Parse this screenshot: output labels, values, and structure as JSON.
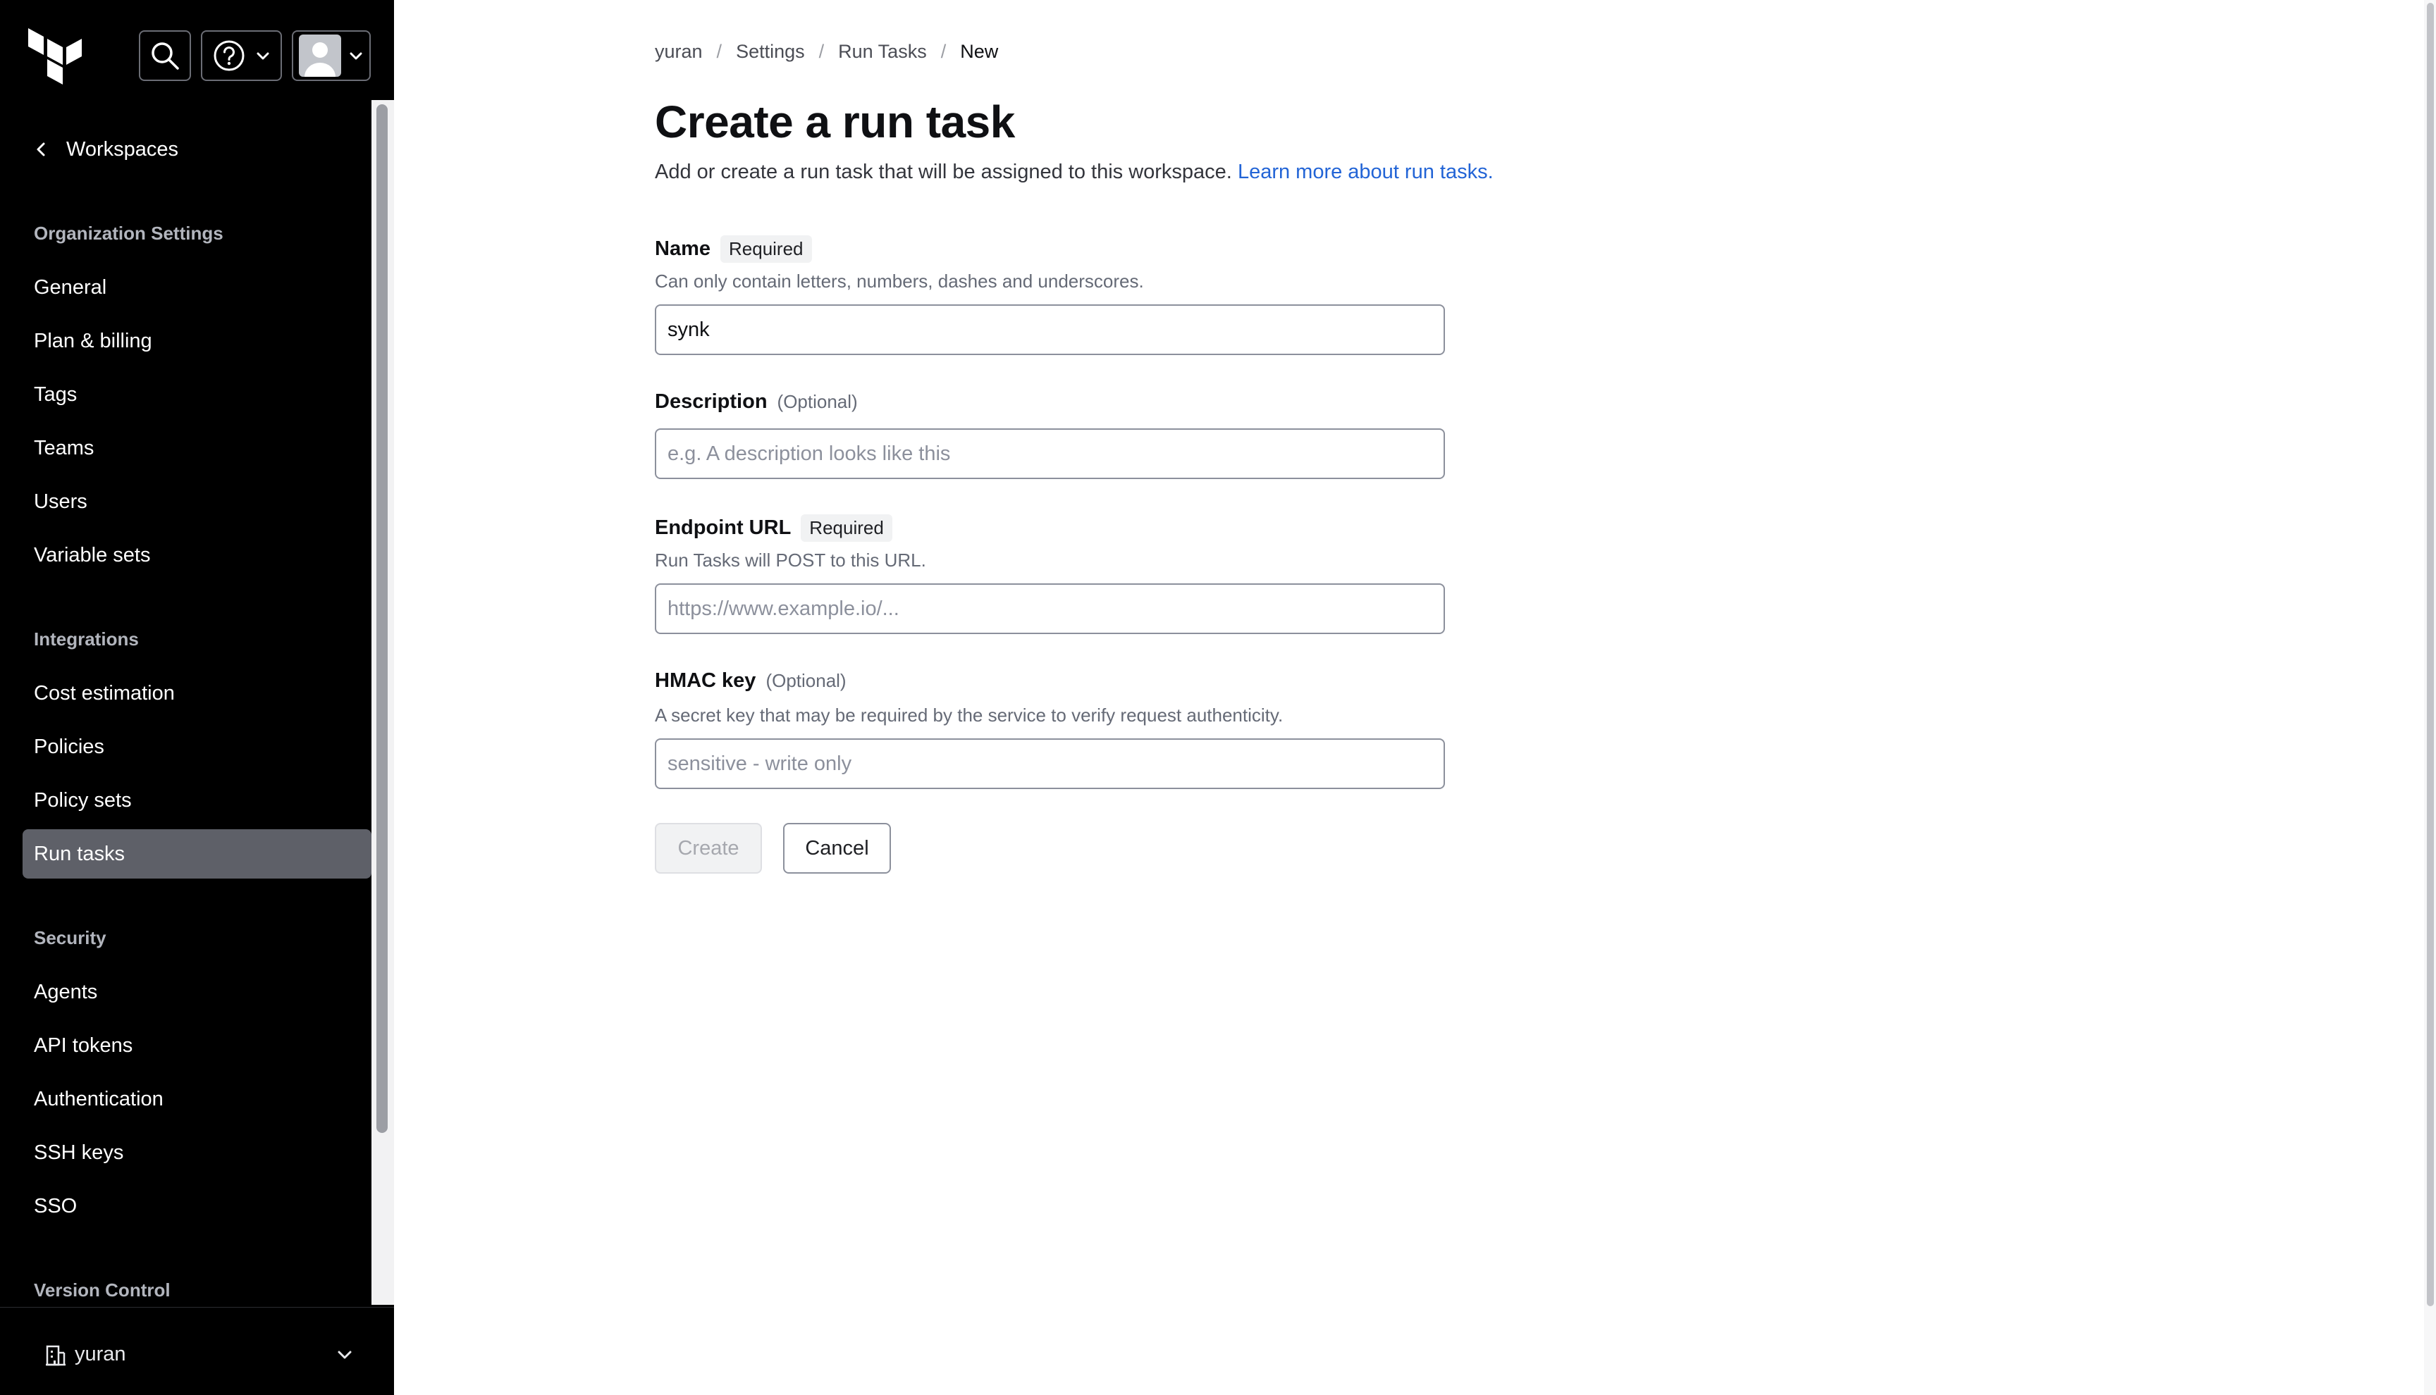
{
  "sidebar": {
    "back_label": "Workspaces",
    "sections": [
      {
        "heading": "Organization Settings",
        "items": [
          "General",
          "Plan & billing",
          "Tags",
          "Teams",
          "Users",
          "Variable sets"
        ]
      },
      {
        "heading": "Integrations",
        "items": [
          "Cost estimation",
          "Policies",
          "Policy sets",
          "Run tasks"
        ]
      },
      {
        "heading": "Security",
        "items": [
          "Agents",
          "API tokens",
          "Authentication",
          "SSH keys",
          "SSO"
        ]
      },
      {
        "heading": "Version Control",
        "items": []
      }
    ],
    "active_item": "Run tasks",
    "org_name": "yuran"
  },
  "breadcrumb": [
    "yuran",
    "Settings",
    "Run Tasks",
    "New"
  ],
  "page": {
    "title": "Create a run task",
    "description": "Add or create a run task that will be assigned to this workspace.",
    "learn_more": "Learn more about run tasks."
  },
  "form": {
    "name": {
      "label": "Name",
      "badge": "Required",
      "help": "Can only contain letters, numbers, dashes and underscores.",
      "value": "synk",
      "placeholder": ""
    },
    "description": {
      "label": "Description",
      "optional": "(Optional)",
      "value": "",
      "placeholder": "e.g. A description looks like this"
    },
    "endpoint": {
      "label": "Endpoint URL",
      "badge": "Required",
      "help": "Run Tasks will POST to this URL.",
      "value": "",
      "placeholder": "https://www.example.io/..."
    },
    "hmac": {
      "label": "HMAC key",
      "optional": "(Optional)",
      "help": "A secret key that may be required by the service to verify request authenticity.",
      "value": "",
      "placeholder": "sensitive - write only"
    },
    "create_label": "Create",
    "cancel_label": "Cancel"
  },
  "icons": {
    "logo": "terraform-logo-icon",
    "search": "search-icon",
    "help": "help-circle-icon",
    "user": "avatar-icon",
    "back": "chevron-left-icon",
    "org": "building-icon",
    "chevron": "chevron-down-icon"
  }
}
